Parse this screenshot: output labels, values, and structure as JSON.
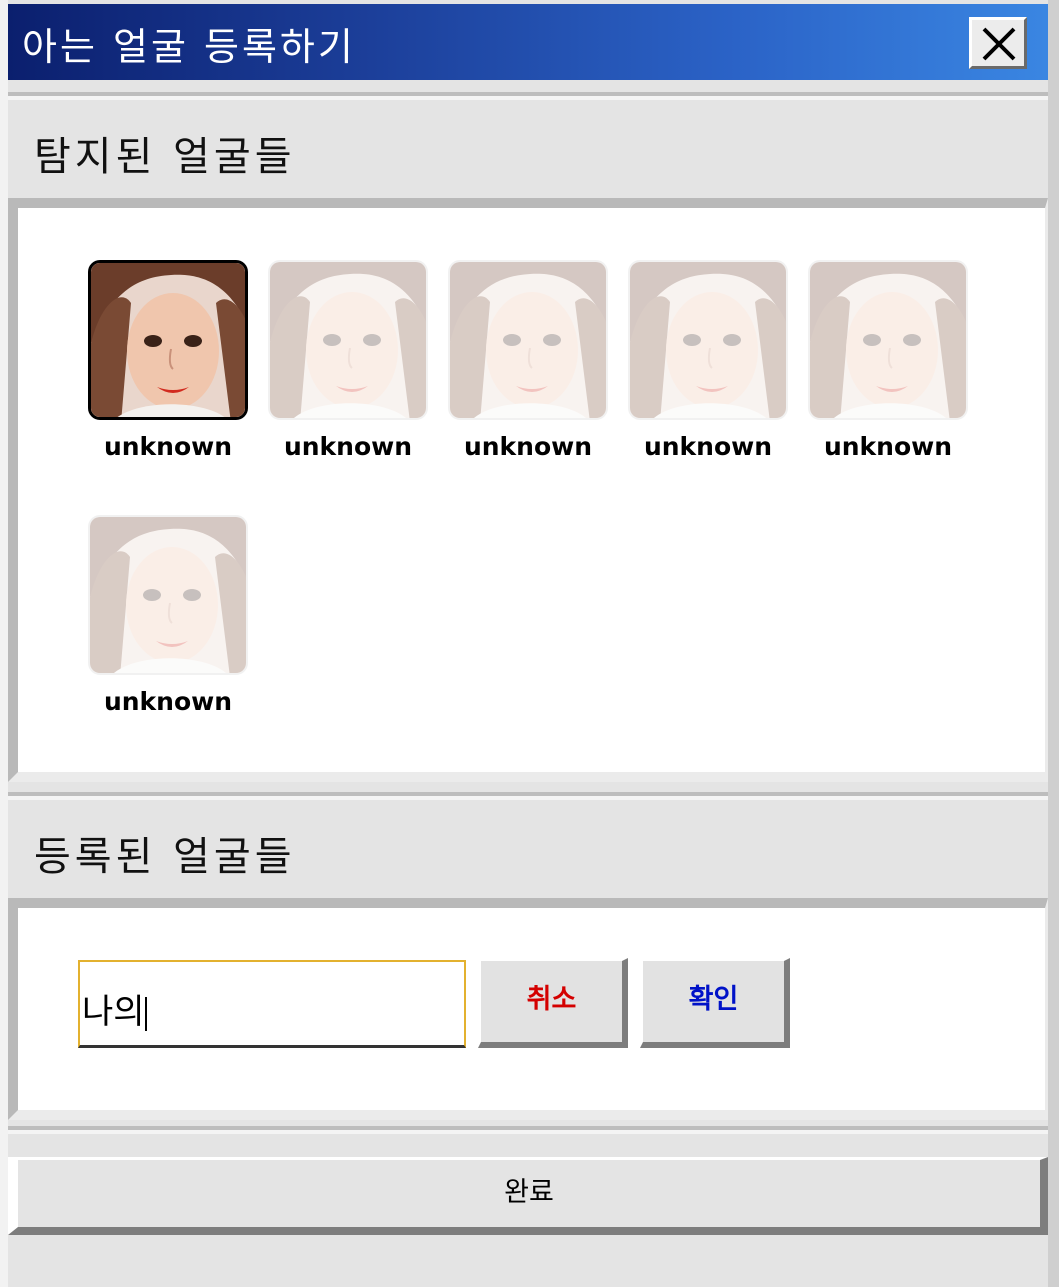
{
  "window": {
    "title": "아는 얼굴 등록하기",
    "close_icon": "close-icon"
  },
  "detected": {
    "header": "탐지된 얼굴들",
    "faces": [
      {
        "label": "unknown",
        "selected": true
      },
      {
        "label": "unknown",
        "selected": false
      },
      {
        "label": "unknown",
        "selected": false
      },
      {
        "label": "unknown",
        "selected": false
      },
      {
        "label": "unknown",
        "selected": false
      },
      {
        "label": "unknown",
        "selected": false
      }
    ]
  },
  "registered": {
    "header": "등록된 얼굴들",
    "name_input_value": "나의",
    "cancel_label": "취소",
    "confirm_label": "확인",
    "cancel_color": "#d40000",
    "confirm_color": "#0012c8"
  },
  "footer": {
    "done_label": "완료"
  },
  "colors": {
    "title_gradient_start": "#0b1f6e",
    "title_gradient_end": "#3a86e2",
    "input_border": "#e3b12f"
  }
}
